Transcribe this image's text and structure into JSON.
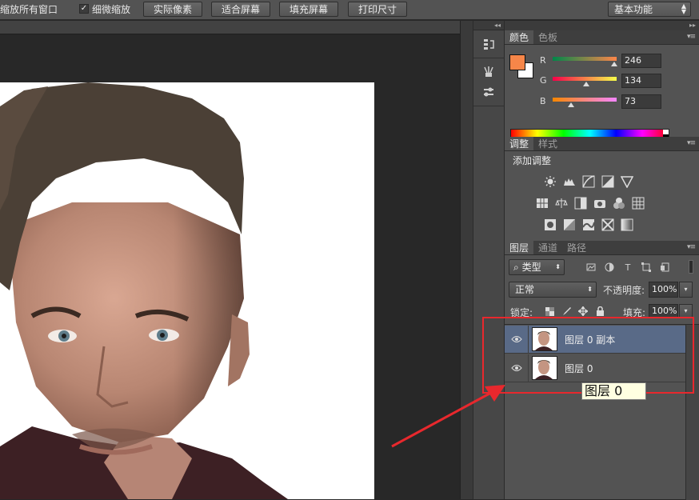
{
  "options_bar": {
    "resize_windows_label": "缩放所有窗口",
    "scrubby_zoom_label": "细微缩放",
    "scrubby_zoom_checked": true,
    "buttons": [
      "实际像素",
      "适合屏幕",
      "填充屏幕",
      "打印尺寸"
    ],
    "workspace": "基本功能"
  },
  "color_panel": {
    "tabs": [
      "颜色",
      "色板"
    ],
    "foreground_color": "#f68649",
    "channels": [
      {
        "label": "R",
        "value": "246"
      },
      {
        "label": "G",
        "value": "134"
      },
      {
        "label": "B",
        "value": "73"
      }
    ]
  },
  "adjustments_panel": {
    "tabs": [
      "调整",
      "样式"
    ],
    "title": "添加调整"
  },
  "layers_panel": {
    "tabs": [
      "图层",
      "通道",
      "路径"
    ],
    "filter_kind": "类型",
    "blend_mode": "正常",
    "opacity_label": "不透明度:",
    "opacity_value": "100%",
    "lock_label": "锁定:",
    "fill_label": "填充:",
    "fill_value": "100%",
    "layers": [
      {
        "name": "图层 0 副本",
        "visible": true,
        "selected": true
      },
      {
        "name": "图层 0",
        "visible": true,
        "selected": false
      }
    ],
    "tooltip": "图层 0"
  },
  "annotation_color": "#e8282d"
}
